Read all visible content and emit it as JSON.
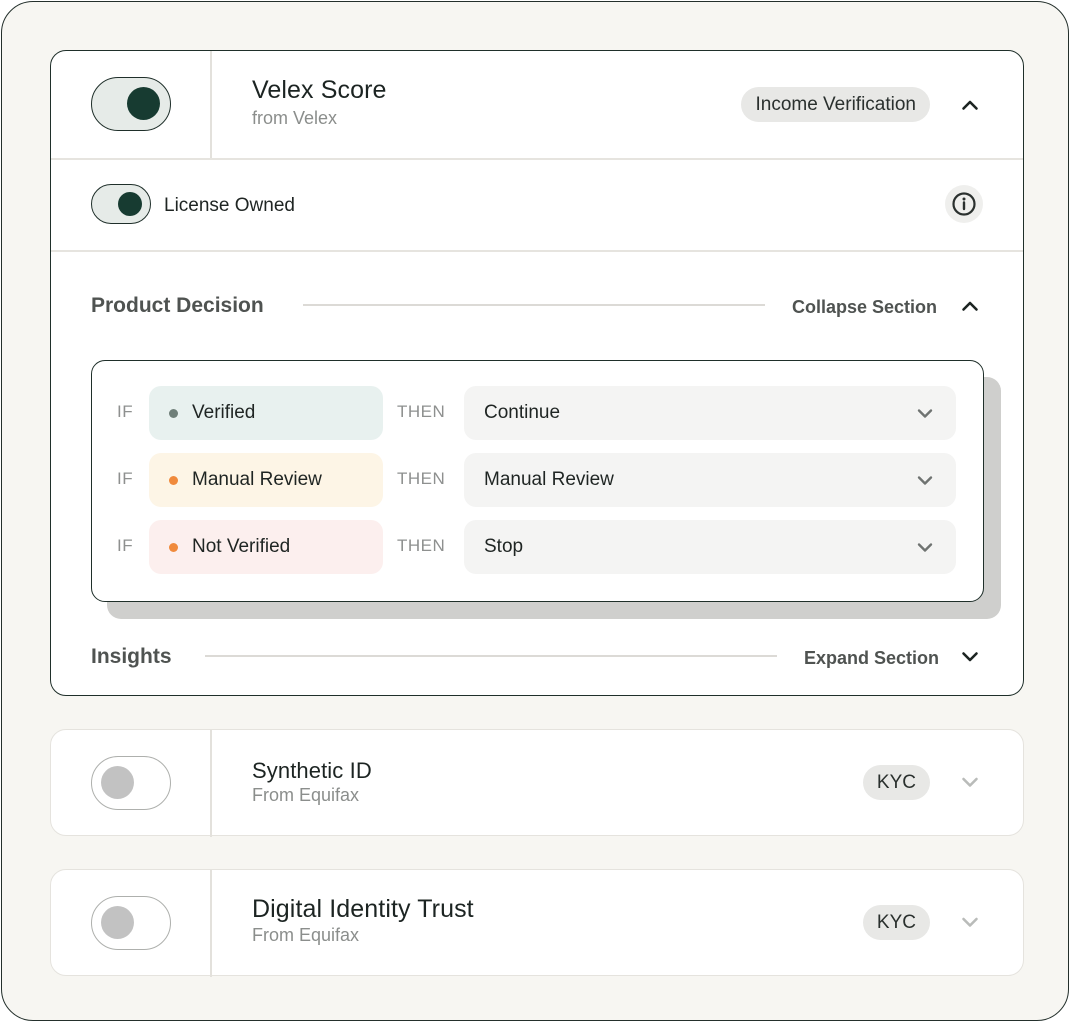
{
  "products": [
    {
      "title": "Velex Score",
      "subtitle": "from Velex",
      "tag": "Income Verification",
      "enabled": true,
      "expanded": true,
      "license_label": "License Owned",
      "sections": {
        "decision": {
          "title": "Product Decision",
          "action": "Collapse Section",
          "if_keyword": "IF",
          "then_keyword": "THEN",
          "rules": [
            {
              "condition": "Verified",
              "action": "Continue",
              "condition_bg": "#e8f1ef",
              "dot_color": "#6f7f79"
            },
            {
              "condition": "Manual Review",
              "action": "Manual Review",
              "condition_bg": "#fdf5e6",
              "dot_color": "#f08a3c"
            },
            {
              "condition": "Not Verified",
              "action": "Stop",
              "condition_bg": "#fcefee",
              "dot_color": "#f08a3c"
            }
          ]
        },
        "insights": {
          "title": "Insights",
          "action": "Expand Section"
        }
      }
    },
    {
      "title": "Synthetic ID",
      "subtitle": "From Equifax",
      "tag": "KYC",
      "enabled": false,
      "expanded": false
    },
    {
      "title": "Digital Identity Trust",
      "subtitle": "From Equifax",
      "tag": "KYC",
      "enabled": false,
      "expanded": false
    }
  ],
  "icons": {
    "chevron_up": "chevron-up-icon",
    "chevron_down": "chevron-down-icon",
    "info": "info-icon"
  },
  "colors": {
    "accent_dark": "#173b31",
    "border_dark": "#1f2f2a",
    "frame_bg": "#f7f6f2"
  }
}
